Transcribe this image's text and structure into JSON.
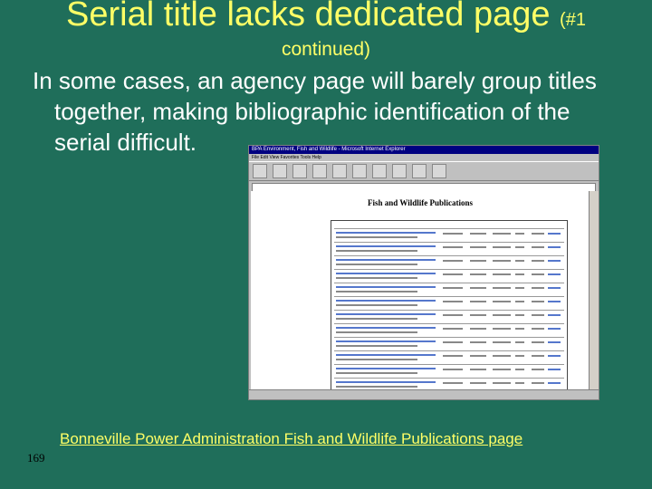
{
  "slide": {
    "title_main": "Serial title lacks dedicated page",
    "title_number": "(#1",
    "title_continued": "continued)",
    "body_lines": [
      "In some cases, an agency page will barely group titles",
      "together, making bibliographic identification of the",
      "serial difficult."
    ],
    "link_text": "Bonneville Power Administration Fish and Wildlife Publications page",
    "slide_number": "169"
  },
  "screenshot": {
    "window_title": "BPA Environment, Fish and Wildlife - Microsoft Internet Explorer",
    "menu": "File  Edit  View  Favorites  Tools  Help",
    "page_heading": "Fish and Wildlife Publications"
  }
}
